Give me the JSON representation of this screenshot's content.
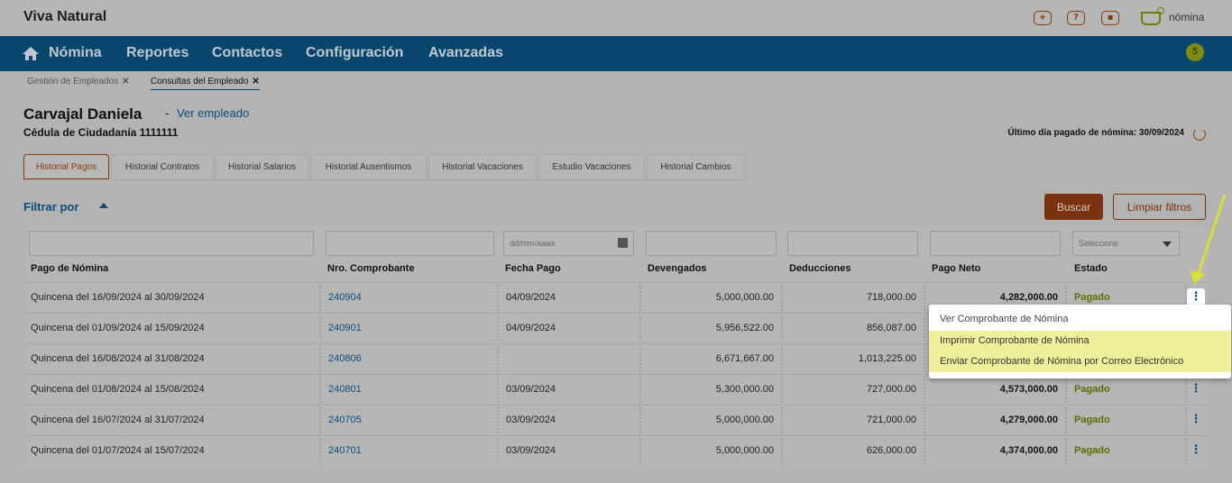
{
  "header": {
    "brand": "Viva Natural",
    "icons": [
      "plus-icon",
      "help-icon",
      "user-icon"
    ],
    "app_name": "nómina"
  },
  "nav": {
    "items": [
      "Nómina",
      "Reportes",
      "Contactos",
      "Configuración",
      "Avanzadas"
    ],
    "badge": "5"
  },
  "breadcrumbs": [
    {
      "label": "Gestión de Empleados"
    },
    {
      "label": "Consultas del Empleado"
    }
  ],
  "employee": {
    "name": "Carvajal Daniela",
    "dash": "-",
    "view_link": "Ver empleado",
    "id_label": "Cédula de Ciudadanía 1111111",
    "last_paid": "Último día pagado de nómina: 30/09/2024"
  },
  "tabs": [
    "Historial Pagos",
    "Historial Contratos",
    "Historial Salarios",
    "Historial Ausentismos",
    "Historial Vacaciones",
    "Estudio Vacaciones",
    "Historial Cambios"
  ],
  "filter": {
    "title": "Filtrar por",
    "search": "Buscar",
    "clear": "Limpiar filtros",
    "date_placeholder": "dd/mm/aaaa",
    "select_placeholder": "Seleccione"
  },
  "table": {
    "columns": [
      "Pago de Nómina",
      "Nro. Comprobante",
      "Fecha Pago",
      "Devengados",
      "Deducciones",
      "Pago Neto",
      "Estado"
    ],
    "rows": [
      [
        "Quincena del 16/09/2024 al 30/09/2024",
        "240904",
        "04/09/2024",
        "5,000,000.00",
        "718,000.00",
        "4,282,000.00",
        "Pagado"
      ],
      [
        "Quincena del 01/09/2024 al 15/09/2024",
        "240901",
        "04/09/2024",
        "5,956,522.00",
        "856,087.00",
        "",
        ""
      ],
      [
        "Quincena del 16/08/2024 al 31/08/2024",
        "240806",
        "",
        "6,671,667.00",
        "1,013,225.00",
        "",
        ""
      ],
      [
        "Quincena del 01/08/2024 al 15/08/2024",
        "240801",
        "03/09/2024",
        "5,300,000.00",
        "727,000.00",
        "4,573,000.00",
        "Pagado"
      ],
      [
        "Quincena del 16/07/2024 al 31/07/2024",
        "240705",
        "03/09/2024",
        "5,000,000.00",
        "721,000.00",
        "4,279,000.00",
        "Pagado"
      ],
      [
        "Quincena del 01/07/2024 al 15/07/2024",
        "240701",
        "03/09/2024",
        "5,000,000.00",
        "626,000.00",
        "4,374,000.00",
        "Pagado"
      ]
    ]
  },
  "menu": [
    "Ver Comprobante de Nómina",
    "Imprimir Comprobante de Nómina",
    "Enviar Comprobante de Nómina por Correo Electrónico"
  ],
  "colors": {
    "nav_bg": "#08466e",
    "accent": "#7a3210",
    "status": "#5a6e00",
    "highlight": "#eef09c"
  }
}
